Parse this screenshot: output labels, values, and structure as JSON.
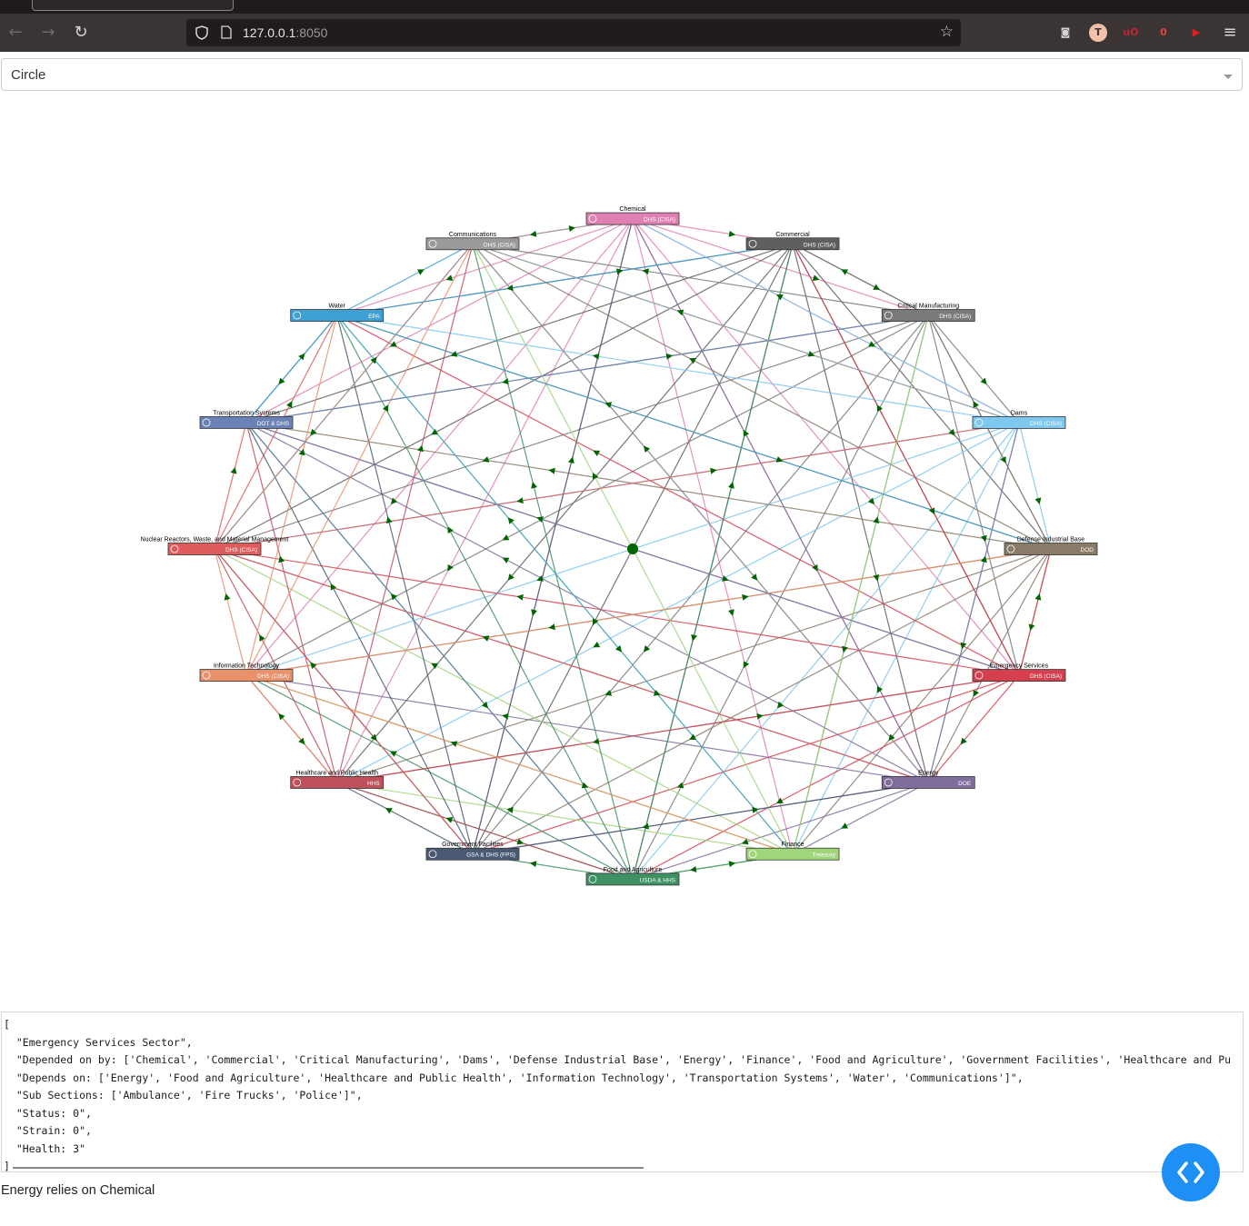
{
  "browser": {
    "url_host": "127.0.0.1",
    "url_port": ":8050",
    "extensions": [
      {
        "name": "pocket-icon",
        "label": "◙",
        "color": "#d8d3d4"
      },
      {
        "name": "account-avatar-icon",
        "label": "T",
        "color": "#f3c1a9"
      },
      {
        "name": "ublock-icon",
        "label": "uO",
        "color": "#c0262d"
      },
      {
        "name": "extension-badge-icon",
        "label": "0",
        "color": "#e04343"
      },
      {
        "name": "youtube-extension-icon",
        "label": "▶",
        "color": "#e02020"
      }
    ]
  },
  "dropdown": {
    "value": "Circle"
  },
  "graph": {
    "node_color_edge": "#006400",
    "nodes": [
      {
        "label": "Chemical",
        "agency": "DHS (CISA)",
        "color": "#e080b2"
      },
      {
        "label": "Commercial",
        "agency": "DHS (CISA)",
        "color": "#5f5f5f"
      },
      {
        "label": "Critical Manufacturing",
        "agency": "DHS (CISA)",
        "color": "#7a7a7a"
      },
      {
        "label": "Dams",
        "agency": "DHS (CISA)",
        "color": "#7ec8ef"
      },
      {
        "label": "Defense Industrial Base",
        "agency": "DOD",
        "color": "#8a7a68"
      },
      {
        "label": "Emergency Services",
        "agency": "DHS (CISA)",
        "color": "#d6404e"
      },
      {
        "label": "Energy",
        "agency": "DOE",
        "color": "#7f6e9c"
      },
      {
        "label": "Finance",
        "agency": "Treasury",
        "color": "#9fd67a"
      },
      {
        "label": "Food and Agriculture",
        "agency": "USDA & HHS",
        "color": "#3f9063"
      },
      {
        "label": "Government Facilities",
        "agency": "GSA & DHS (FPS)",
        "color": "#4a5a73"
      },
      {
        "label": "Healthcare and Public Health",
        "agency": "HHS",
        "color": "#c0505a"
      },
      {
        "label": "Information Technology",
        "agency": "DHS (CISA)",
        "color": "#e8916a"
      },
      {
        "label": "Nuclear Reactors, Waste, and Material Management",
        "agency": "DHS (CISA)",
        "color": "#e05c5c"
      },
      {
        "label": "Transportation Systems",
        "agency": "DOT & DHS",
        "color": "#6a82b5"
      },
      {
        "label": "Water",
        "agency": "EPA",
        "color": "#3ea0d3"
      },
      {
        "label": "Communications",
        "agency": "DHS (CISA)",
        "color": "#9a9a9a"
      }
    ]
  },
  "details": {
    "lines": [
      "[",
      "  \"Emergency Services Sector\",",
      "  \"Depended on by: ['Chemical', 'Commercial', 'Critical Manufacturing', 'Dams', 'Defense Industrial Base', 'Energy', 'Finance', 'Food and Agriculture', 'Government Facilities', 'Healthcare and Pu",
      "  \"Depends on: ['Energy', 'Food and Agriculture', 'Healthcare and Public Health', 'Information Technology', 'Transportation Systems', 'Water', 'Communications']\",",
      "  \"Sub Sections: ['Ambulance', 'Fire Trucks', 'Police']\",",
      "  \"Status: 0\",",
      "  \"Strain: 0\",",
      "  \"Health: 3\"",
      "]"
    ]
  },
  "status_text": "Energy relies on Chemical"
}
